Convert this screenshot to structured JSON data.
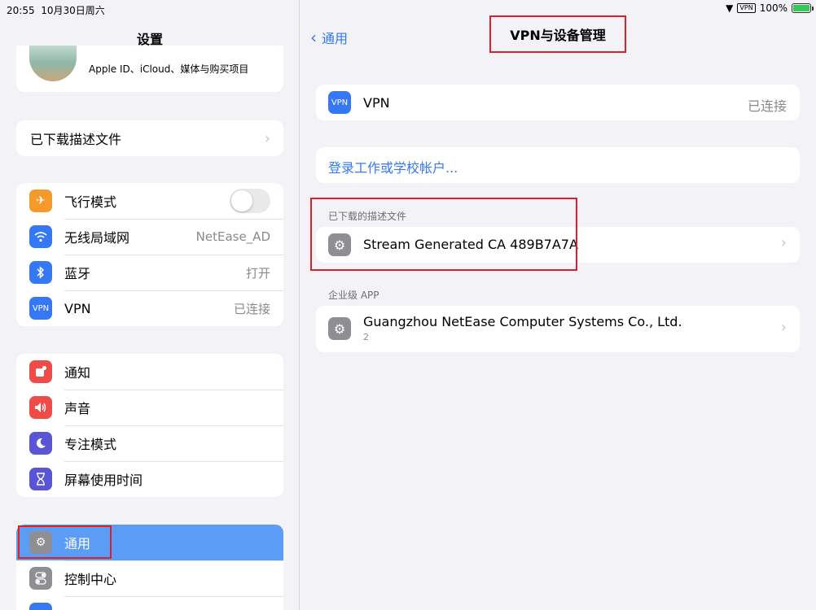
{
  "status": {
    "time": "20:55",
    "date": "10月30日周六",
    "vpn": "VPN",
    "battery": "100%"
  },
  "sidebar": {
    "title": "设置",
    "apple_id_text": "Apple ID、iCloud、媒体与购买项目",
    "downloaded_profile": "已下载描述文件",
    "group1": [
      {
        "label": "飞行模式",
        "icon": "airplane-icon",
        "color": "#f39a2b"
      },
      {
        "label": "无线局域网",
        "value": "NetEase_AD",
        "icon": "wifi-icon",
        "color": "#3478f6"
      },
      {
        "label": "蓝牙",
        "value": "打开",
        "icon": "bluetooth-icon",
        "color": "#3478f6"
      },
      {
        "label": "VPN",
        "value": "已连接",
        "icon": "vpn-icon",
        "icon_text": "VPN",
        "color": "#3478f6"
      }
    ],
    "group2": [
      {
        "label": "通知",
        "icon": "notification-icon",
        "color": "#ef4b48"
      },
      {
        "label": "声音",
        "icon": "sound-icon",
        "color": "#ef4b48"
      },
      {
        "label": "专注模式",
        "icon": "moon-icon",
        "color": "#5a54d6"
      },
      {
        "label": "屏幕使用时间",
        "icon": "hourglass-icon",
        "color": "#5a54d6"
      }
    ],
    "group3": [
      {
        "label": "通用",
        "icon": "gear-icon",
        "color": "#8e8e93"
      },
      {
        "label": "控制中心",
        "icon": "switch-icon",
        "color": "#8e8e93"
      }
    ]
  },
  "main": {
    "back_label": "通用",
    "title": "VPN与设备管理",
    "vpn_icon_text": "VPN",
    "vpn_label": "VPN",
    "vpn_status": "已连接",
    "signin_link": "登录工作或学校帐户...",
    "downloaded_section": "已下载的描述文件",
    "profile_name": "Stream Generated CA 489B7A7A",
    "enterprise_section": "企业级 APP",
    "enterprise_name": "Guangzhou NetEase Computer Systems Co., Ltd.",
    "enterprise_count": "2"
  },
  "colors": {
    "accent": "#3478f6",
    "selected_row": "#5b9cf6",
    "highlight_box": "#d8232a"
  }
}
